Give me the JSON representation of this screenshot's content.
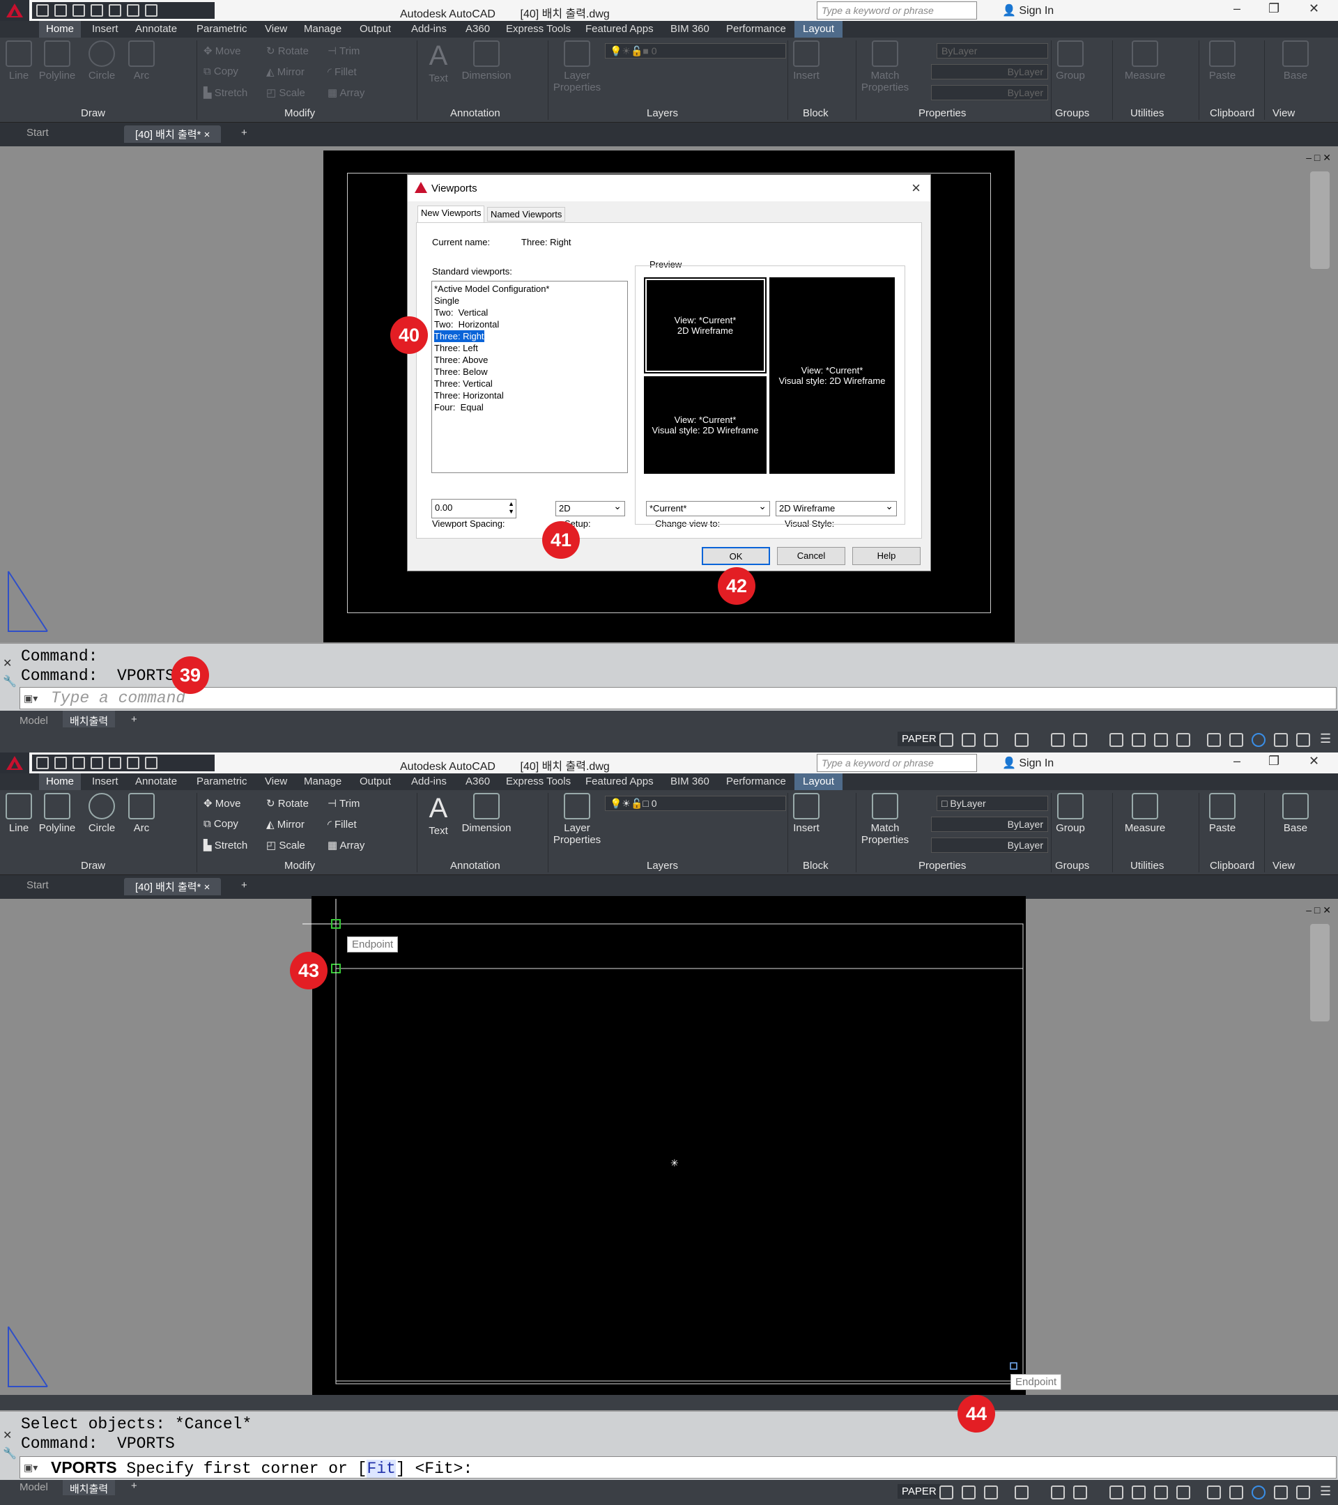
{
  "app": {
    "title": "Autodesk AutoCAD",
    "document": "[40] 배치 출력.dwg",
    "search_placeholder": "Type a keyword or phrase",
    "sign_in": "Sign In"
  },
  "ribbon_tabs": [
    "Home",
    "Insert",
    "Annotate",
    "Parametric",
    "View",
    "Manage",
    "Output",
    "Add-ins",
    "A360",
    "Express Tools",
    "Featured Apps",
    "BIM 360",
    "Performance",
    "Layout"
  ],
  "ribbon": {
    "draw": {
      "line": "Line",
      "polyline": "Polyline",
      "circle": "Circle",
      "arc": "Arc",
      "panel": "Draw"
    },
    "modify": {
      "move": "Move",
      "rotate": "Rotate",
      "trim": "Trim",
      "copy": "Copy",
      "mirror": "Mirror",
      "fillet": "Fillet",
      "stretch": "Stretch",
      "scale": "Scale",
      "array": "Array",
      "panel": "Modify"
    },
    "annotation": {
      "text": "Text",
      "dimension": "Dimension",
      "panel": "Annotation"
    },
    "layers": {
      "layer_properties_1": "Layer",
      "layer_properties_2": "Properties",
      "current_layer": "0",
      "panel": "Layers"
    },
    "block": {
      "insert": "Insert",
      "panel": "Block"
    },
    "properties": {
      "match_1": "Match",
      "match_2": "Properties",
      "color": "ByLayer",
      "linetype": "ByLayer",
      "lineweight": "ByLayer",
      "panel": "Properties"
    },
    "groups": {
      "group": "Group",
      "panel": "Groups"
    },
    "utilities": {
      "measure": "Measure",
      "panel": "Utilities"
    },
    "clipboard": {
      "paste": "Paste",
      "panel": "Clipboard"
    },
    "view": {
      "base": "Base",
      "panel": "View"
    }
  },
  "file_tabs": {
    "start": "Start",
    "doc": "[40] 배치 출력*"
  },
  "layout_tabs": {
    "model": "Model",
    "layout": "배치출력"
  },
  "status": {
    "paper": "PAPER"
  },
  "dialog": {
    "title": "Viewports",
    "tab_new": "New Viewports",
    "tab_named": "Named Viewports",
    "current_name_label": "Current name:",
    "current_name_value": "Three: Right",
    "standard_label": "Standard viewports:",
    "standard_items": [
      "*Active Model Configuration*",
      "Single",
      "Two:  Vertical",
      "Two:  Horizontal",
      "Three: Right",
      "Three: Left",
      "Three: Above",
      "Three: Below",
      "Three: Vertical",
      "Three: Horizontal",
      "Four:  Equal"
    ],
    "selected_item": "Three: Right",
    "preview_label": "Preview",
    "preview_tl": "View: *Current*\n2D Wireframe",
    "preview_bl": "View: *Current*\nVisual style: 2D Wireframe",
    "preview_r": "View: *Current*\nVisual style: 2D Wireframe",
    "spacing_label": "Viewport Spacing:",
    "spacing_value": "0.00",
    "setup_label": "Setup:",
    "setup_value": "2D",
    "change_view_label": "Change view to:",
    "change_view_value": "*Current*",
    "visual_style_label": "Visual Style:",
    "visual_style_value": "2D Wireframe",
    "ok": "OK",
    "cancel": "Cancel",
    "help": "Help"
  },
  "top": {
    "cmd_history": [
      "Command:",
      "Command:  VPORTS"
    ],
    "cmd_placeholder": "Type a command"
  },
  "bottom": {
    "cmd_history": [
      "Select objects: *Cancel*",
      "Command:  VPORTS"
    ],
    "cmd_prompt_bold": "VPORTS",
    "cmd_prompt_a": " Specify first corner or [",
    "cmd_prompt_fit": "Fit",
    "cmd_prompt_b": "] <Fit>:",
    "snap_tooltip_1": "Endpoint",
    "snap_tooltip_2": "Endpoint"
  },
  "badges": [
    "39",
    "40",
    "41",
    "42",
    "43",
    "44"
  ],
  "colors": {
    "badge": "#e31e24",
    "selection": "#0a64d8",
    "snap": "#37c837",
    "autocad_red": "#c8102e"
  }
}
